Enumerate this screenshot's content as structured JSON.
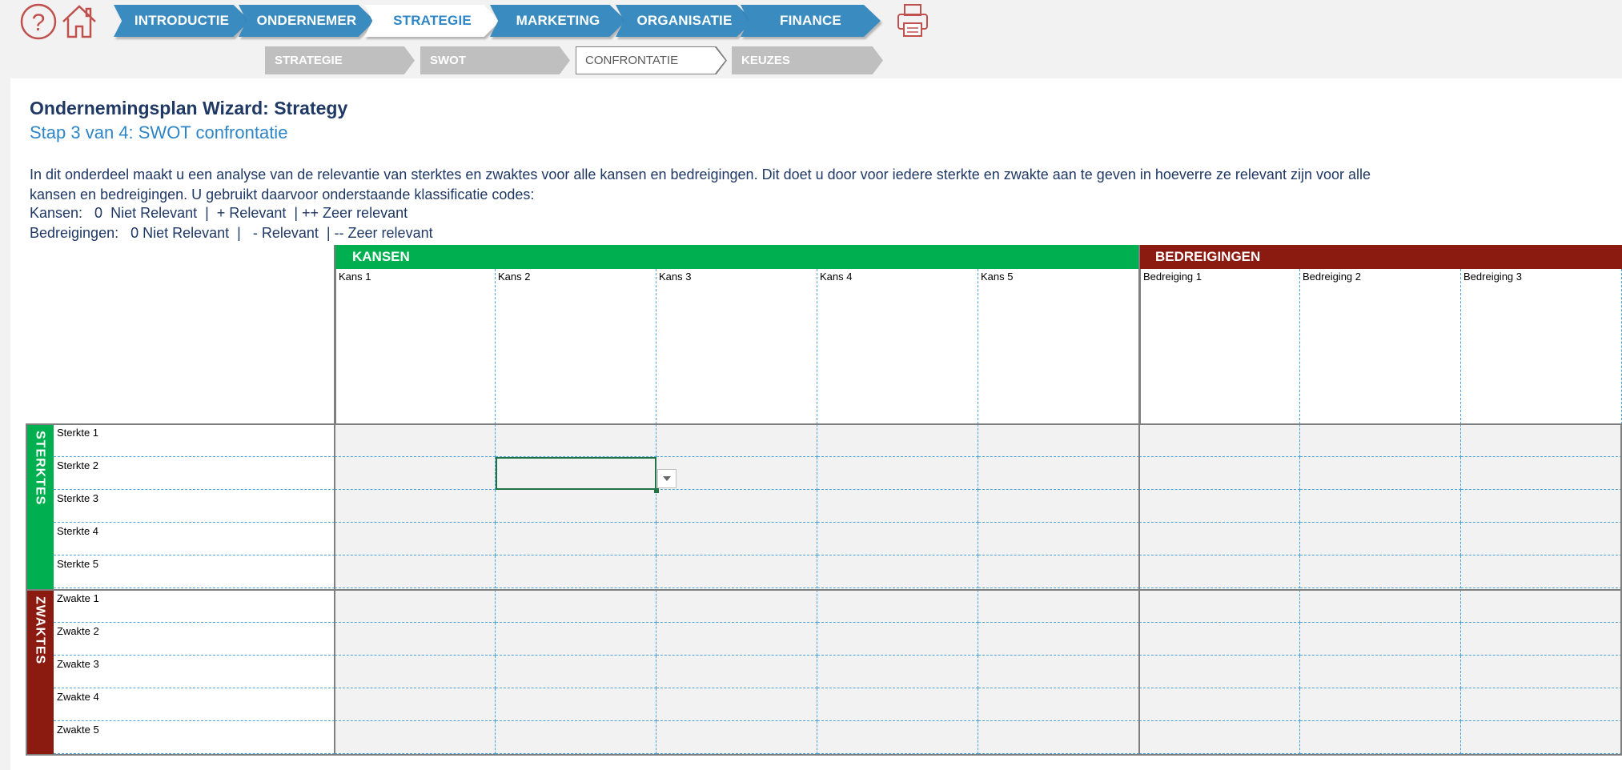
{
  "ribbon": {
    "help_icon": "question-mark-icon",
    "home_icon": "home-icon",
    "print_icon": "printer-icon",
    "main_tabs": [
      {
        "label": "INTRODUCTIE"
      },
      {
        "label": "ONDERNEMER"
      },
      {
        "label": "STRATEGIE",
        "active": true
      },
      {
        "label": "MARKETING"
      },
      {
        "label": "ORGANISATIE"
      },
      {
        "label": "FINANCE"
      }
    ],
    "sub_tabs": [
      {
        "label": "STRATEGIE"
      },
      {
        "label": "SWOT"
      },
      {
        "label": "CONFRONTATIE",
        "active": true
      },
      {
        "label": "KEUZES"
      }
    ]
  },
  "page": {
    "title": "Ondernemingsplan Wizard: Strategy",
    "subtitle": "Stap 3 van 4: SWOT confrontatie",
    "intro_line1": "In dit onderdeel maakt u een analyse van de relevantie van sterktes en zwaktes voor alle kansen en bedreigingen. Dit doet u door voor iedere sterkte en zwakte aan te geven in hoeverre ze relevant zijn voor alle",
    "intro_line2": "kansen en bedreigingen. U gebruikt daarvoor onderstaande klassificatie codes:",
    "legend_kansen": "Kansen:   0  Niet Relevant  |  + Relevant  | ++ Zeer relevant",
    "legend_bedreigingen": "Bedreigingen:   0 Niet Relevant  |   - Relevant  | -- Zeer relevant"
  },
  "grid": {
    "kansen_label": "KANSEN",
    "bedreigingen_label": "BEDREIGINGEN",
    "sterktes_label": "STERKTES",
    "zwaktes_label": "ZWAKTES",
    "kansen": [
      "Kans 1",
      "Kans 2",
      "Kans 3",
      "Kans 4",
      "Kans 5"
    ],
    "bedreigingen": [
      "Bedreiging 1",
      "Bedreiging 2",
      "Bedreiging 3"
    ],
    "sterktes": [
      "Sterkte 1",
      "Sterkte 2",
      "Sterkte 3",
      "Sterkte 4",
      "Sterkte 5"
    ],
    "zwaktes": [
      "Zwakte 1",
      "Zwakte 2",
      "Zwakte 3",
      "Zwakte 4",
      "Zwakte 5"
    ],
    "selected_cell": {
      "row": "Sterkte 2",
      "column": "Kans 2"
    }
  },
  "colors": {
    "tab_blue": "#3a8bbf",
    "kansen_green": "#00b050",
    "bedreigingen_red": "#8b1a10",
    "title_navy": "#1f3864",
    "subtitle_blue": "#2f86c6"
  }
}
